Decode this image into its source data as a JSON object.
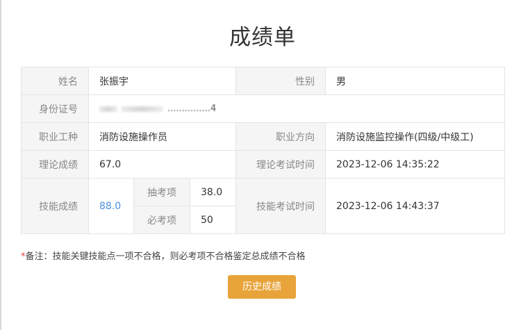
{
  "page": {
    "title": "成绩单"
  },
  "record": {
    "name_label": "姓名",
    "name": "张振宇",
    "gender_label": "性别",
    "gender": "男",
    "id_label": "身份证号",
    "id_visible_tail": "...............4",
    "job_label": "职业工种",
    "job": "消防设施操作员",
    "direction_label": "职业方向",
    "direction": "消防设施监控操作(四级/中级工)",
    "theory_label": "理论成绩",
    "theory_score": "67.0",
    "theory_time_label": "理论考试时间",
    "theory_time": "2023-12-06 14:35:22",
    "skill_label": "技能成绩",
    "skill_score": "88.0",
    "random_label": "抽考项",
    "random_score": "38.0",
    "required_label": "必考项",
    "required_score": "50",
    "skill_time_label": "技能考试时间",
    "skill_time": "2023-12-06 14:43:37"
  },
  "note": {
    "star": "*",
    "text": "备注：技能关键技能点一项不合格，则必考项不合格鉴定总成绩不合格"
  },
  "actions": {
    "history_label": "历史成绩"
  },
  "colors": {
    "accent_button": "#e8a43a",
    "skill_score": "#4a90d9",
    "required_star": "#e53935"
  }
}
